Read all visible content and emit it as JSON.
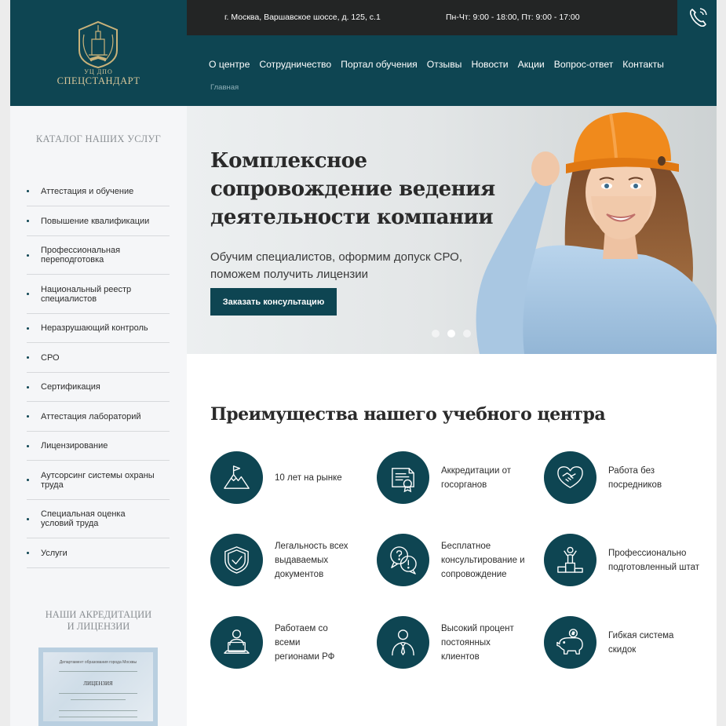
{
  "header": {
    "logo": {
      "line1": "УЦ ДПО",
      "line2": "СПЕЦСТАНДАРТ"
    },
    "address": "г. Москва, Варшавское шоссе, д. 125, с.1",
    "hours": "Пн-Чт: 9:00 - 18:00, Пт: 9:00 - 17:00",
    "nav": [
      "О центре",
      "Сотрудничество",
      "Портал обучения",
      "Отзывы",
      "Новости",
      "Акции",
      "Вопрос-ответ",
      "Контакты"
    ],
    "breadcrumb": "Главная"
  },
  "sidebar": {
    "catalog_title": "КАТАЛОГ НАШИХ УСЛУГ",
    "items": [
      "Аттестация и обучение",
      "Повышение квалификации",
      "Профессиональная переподготовка",
      "Национальный реестр специалистов",
      "Неразрушающий контроль",
      "СРО",
      "Сертификация",
      "Аттестация лабораторий",
      "Лицензирование",
      "Аутсорсинг системы охраны труда",
      "Специальная оценка условий труда",
      "Услуги"
    ],
    "accreditation_title_1": "НАШИ АКРЕДИТАЦИИ",
    "accreditation_title_2": "И ЛИЦЕНЗИИ",
    "license_heading": "Департамент образования города Москвы",
    "license_word": "ЛИЦЕНЗИЯ"
  },
  "hero": {
    "title": "Комплексное сопровождение ведения деятельности компании",
    "subtitle": "Обучим специалистов, оформим допуск СРО, поможем получить лицензии",
    "button": "Заказать консультацию",
    "slides": 3,
    "active_slide": 2
  },
  "advantages": {
    "title": "Преимущества нашего учебного центра",
    "items": [
      {
        "icon": "mountain-flag-icon",
        "text": "10 лет на рынке"
      },
      {
        "icon": "certificate-icon",
        "text": "Аккредитации от госорганов"
      },
      {
        "icon": "handshake-icon",
        "text": "Работа без посредников"
      },
      {
        "icon": "shield-check-icon",
        "text": "Легальность всех выдаваемых документов"
      },
      {
        "icon": "chat-question-icon",
        "text": "Бесплатное консультирование и сопровождение"
      },
      {
        "icon": "podium-person-icon",
        "text": "Профессионально подготовленный штат"
      },
      {
        "icon": "laptop-user-icon",
        "text": "Работаем со всеми регионами РФ"
      },
      {
        "icon": "businessman-icon",
        "text": "Высокий процент постоянных клиентов"
      },
      {
        "icon": "piggy-bank-icon",
        "text": "Гибкая система скидок"
      }
    ]
  },
  "colors": {
    "brand": "#0e4552",
    "topbar": "#232525",
    "sidebar_bg": "#f5f6f8"
  }
}
